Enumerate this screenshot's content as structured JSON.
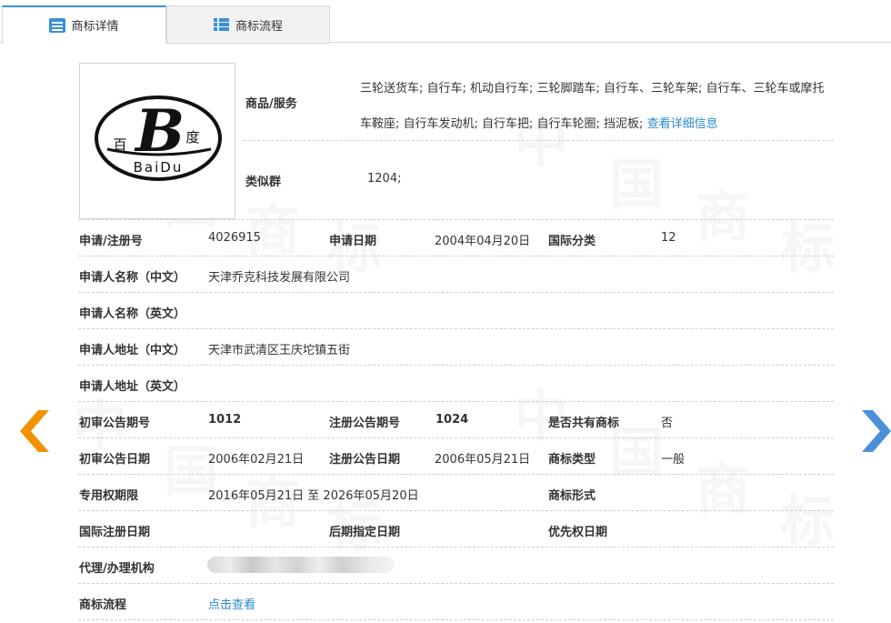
{
  "tabs": [
    {
      "label": "商标详情",
      "active": true
    },
    {
      "label": "商标流程",
      "active": false
    }
  ],
  "watermark": {
    "chars": [
      "中",
      "国",
      "商",
      "标"
    ]
  },
  "logo": {
    "letter": "B",
    "text_left": "百",
    "text_right": "度",
    "text_bottom": "BaiDu"
  },
  "goods": {
    "label": "商品/服务",
    "value": "三轮送货车; 自行车; 机动自行车; 三轮脚踏车; 自行车、三轮车架; 自行车、三轮车或摩托车鞍座; 自行车发动机; 自行车把; 自行车轮圈; 挡泥板;",
    "link": "查看详细信息"
  },
  "similar_group": {
    "label": "类似群",
    "value": "1204;"
  },
  "rows": {
    "app_no_label": "申请/注册号",
    "app_no": "4026915",
    "app_date_label": "申请日期",
    "app_date": "2004年04月20日",
    "intl_class_label": "国际分类",
    "intl_class": "12",
    "applicant_cn_label": "申请人名称（中文）",
    "applicant_cn": "天津乔克科技发展有限公司",
    "applicant_en_label": "申请人名称（英文）",
    "applicant_en": "",
    "address_cn_label": "申请人地址（中文）",
    "address_cn": "天津市武清区王庆坨镇五街",
    "address_en_label": "申请人地址（英文）",
    "address_en": "",
    "prelim_no_label": "初审公告期号",
    "prelim_no": "1012",
    "reg_no_label": "注册公告期号",
    "reg_no": "1024",
    "shared_label": "是否共有商标",
    "shared": "否",
    "prelim_date_label": "初审公告日期",
    "prelim_date": "2006年02月21日",
    "reg_date_label": "注册公告日期",
    "reg_date": "2006年05月21日",
    "type_label": "商标类型",
    "type": "一般",
    "exclusive_label": "专用权期限",
    "exclusive": "2016年05月21日 至 2026年05月20日",
    "form_label": "商标形式",
    "form": "",
    "intl_reg_label": "国际注册日期",
    "intl_reg": "",
    "later_label": "后期指定日期",
    "later": "",
    "priority_label": "优先权日期",
    "priority": "",
    "agent_label": "代理/办理机构",
    "flow_label": "商标流程",
    "flow_link": "点击查看"
  },
  "colors": {
    "accent": "#3b8fd9",
    "link": "#2a8bcf",
    "prev_arrow": "#f39200",
    "next_arrow": "#4a90d9"
  }
}
